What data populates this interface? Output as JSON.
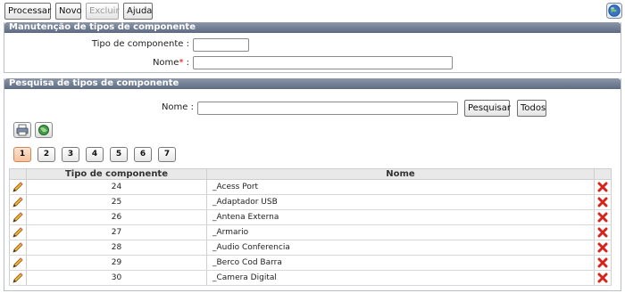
{
  "toolbar": {
    "processar_label": "Processar",
    "novo_label": "Novo",
    "excluir_label": "Excluir",
    "ajuda_label": "Ajuda"
  },
  "manutencao": {
    "title": "Manutenção de tipos de componente",
    "tipo_label": "Tipo de componente :",
    "tipo_value": "",
    "nome_label": "Nome",
    "nome_required": "*",
    "nome_colon": ":",
    "nome_value": ""
  },
  "pesquisa": {
    "title": "Pesquisa de tipos de componente",
    "nome_label": "Nome :",
    "nome_value": "",
    "pesquisar_label": "Pesquisar",
    "todos_label": "Todos"
  },
  "pagination": {
    "pages": [
      "1",
      "2",
      "3",
      "4",
      "5",
      "6",
      "7"
    ],
    "current": "1"
  },
  "grid": {
    "headers": {
      "tipo": "Tipo de componente",
      "nome": "Nome"
    },
    "rows": [
      {
        "tipo": "24",
        "nome": "_Acess Port"
      },
      {
        "tipo": "25",
        "nome": "_Adaptador USB"
      },
      {
        "tipo": "26",
        "nome": "_Antena Externa"
      },
      {
        "tipo": "27",
        "nome": "_Armario"
      },
      {
        "tipo": "28",
        "nome": "_Audio Conferencia"
      },
      {
        "tipo": "29",
        "nome": "_Berco Cod Barra"
      },
      {
        "tipo": "30",
        "nome": "_Camera Digital"
      }
    ]
  },
  "colors": {
    "panel_header": "#6b778b",
    "delete_icon": "#d4241b",
    "required": "#d40000",
    "active_page": "#f6c19d"
  },
  "icons": {
    "help": "help-globe-icon",
    "print": "print-icon",
    "export": "export-globe-icon",
    "edit": "pencil-icon",
    "delete": "delete-x-icon"
  }
}
